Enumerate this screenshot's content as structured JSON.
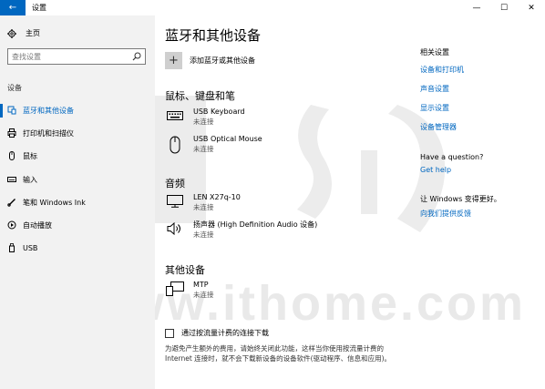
{
  "window": {
    "title": "设置",
    "back_glyph": "←",
    "min_glyph": "—",
    "max_glyph": "☐",
    "close_glyph": "✕"
  },
  "sidebar": {
    "home_label": "主页",
    "search_placeholder": "查找设置",
    "section_label": "设备",
    "items": [
      {
        "label": "蓝牙和其他设备",
        "icon": "bluetooth-devices-icon",
        "active": true
      },
      {
        "label": "打印机和扫描仪",
        "icon": "printer-icon"
      },
      {
        "label": "鼠标",
        "icon": "mouse-icon"
      },
      {
        "label": "输入",
        "icon": "keyboard-icon"
      },
      {
        "label": "笔和 Windows Ink",
        "icon": "pen-icon"
      },
      {
        "label": "自动播放",
        "icon": "autoplay-icon"
      },
      {
        "label": "USB",
        "icon": "usb-icon"
      }
    ]
  },
  "main": {
    "title": "蓝牙和其他设备",
    "add_label": "添加蓝牙或其他设备",
    "groups": {
      "mouse_keyboard": {
        "title": "鼠标、键盘和笔",
        "devices": [
          {
            "name": "USB Keyboard",
            "status": "未连接",
            "icon": "keyboard-icon"
          },
          {
            "name": "USB Optical Mouse",
            "status": "未连接",
            "icon": "mouse-icon"
          }
        ]
      },
      "audio": {
        "title": "音频",
        "devices": [
          {
            "name": "LEN X27q-10",
            "status": "未连接",
            "icon": "monitor-icon"
          },
          {
            "name": "扬声器 (High Definition Audio 设备)",
            "status": "未连接",
            "icon": "speaker-icon"
          }
        ]
      },
      "other": {
        "title": "其他设备",
        "devices": [
          {
            "name": "MTP",
            "status": "未连接",
            "icon": "mtp-device-icon"
          }
        ]
      }
    },
    "metered": {
      "label": "通过按流量计费的连接下载",
      "checked": false,
      "description": "为避免产生额外的费用，请始终关闭此功能，这样当你使用按流量计费的 Internet 连接时，就不会下载新设备的设备软件(驱动程序、信息和应用)。"
    }
  },
  "related": {
    "heading": "相关设置",
    "links": [
      "设备和打印机",
      "声音设置",
      "显示设置",
      "设备管理器"
    ],
    "question_heading": "Have a question?",
    "help_link": "Get help",
    "feedback_heading": "让 Windows 变得更好。",
    "feedback_link": "向我们提供反馈"
  },
  "watermark": {
    "text": "www.ithome.com"
  },
  "colors": {
    "accent": "#0067c0",
    "sidebar_bg": "#f2f2f2",
    "watermark": "#e9e9e9"
  }
}
